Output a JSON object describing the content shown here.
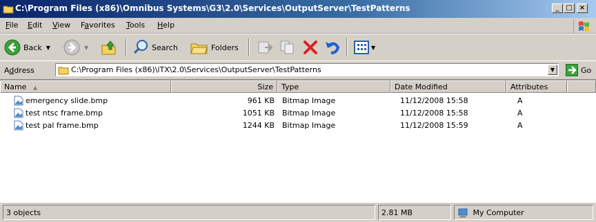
{
  "window": {
    "title": "C:\\Program Files (x86)\\Omnibus Systems\\G3\\2.0\\Services\\OutputServer\\TestPatterns",
    "buttons": {
      "minimize": "_",
      "maximize": "□",
      "close": "×"
    }
  },
  "menu": {
    "items": [
      {
        "pre": "",
        "key": "F",
        "post": "ile"
      },
      {
        "pre": "",
        "key": "E",
        "post": "dit"
      },
      {
        "pre": "",
        "key": "V",
        "post": "iew"
      },
      {
        "pre": "F",
        "key": "a",
        "post": "vorites"
      },
      {
        "pre": "",
        "key": "T",
        "post": "ools"
      },
      {
        "pre": "",
        "key": "H",
        "post": "elp"
      }
    ]
  },
  "toolbar": {
    "back_label": "Back",
    "search_label": "Search",
    "folders_label": "Folders"
  },
  "address": {
    "label_pre": "A",
    "label_key": "d",
    "label_post": "dress",
    "value": "C:\\Program Files (x86)\\iTX\\2.0\\Services\\OutputServer\\TestPatterns",
    "go_label": "Go"
  },
  "list": {
    "columns": [
      "Name",
      "Size",
      "Type",
      "Date Modified",
      "Attributes"
    ],
    "rows": [
      {
        "name": "emergency slide.bmp",
        "size": "961 KB",
        "type": "Bitmap Image",
        "modified": "11/12/2008 15:58",
        "attributes": "A"
      },
      {
        "name": "test ntsc frame.bmp",
        "size": "1051 KB",
        "type": "Bitmap Image",
        "modified": "11/12/2008 15:58",
        "attributes": "A"
      },
      {
        "name": "test pal frame.bmp",
        "size": "1244 KB",
        "type": "Bitmap Image",
        "modified": "11/12/2008 15:59",
        "attributes": "A"
      }
    ]
  },
  "status": {
    "objects": "3 objects",
    "size": "2.81 MB",
    "zone": "My Computer"
  },
  "icons": [
    "folder-icon",
    "windows-logo-icon",
    "back-icon",
    "forward-icon",
    "up-folder-icon",
    "search-icon",
    "folders-icon",
    "move-to-icon",
    "copy-to-icon",
    "delete-icon",
    "undo-icon",
    "views-icon",
    "go-icon",
    "bitmap-file-icon",
    "my-computer-icon"
  ]
}
